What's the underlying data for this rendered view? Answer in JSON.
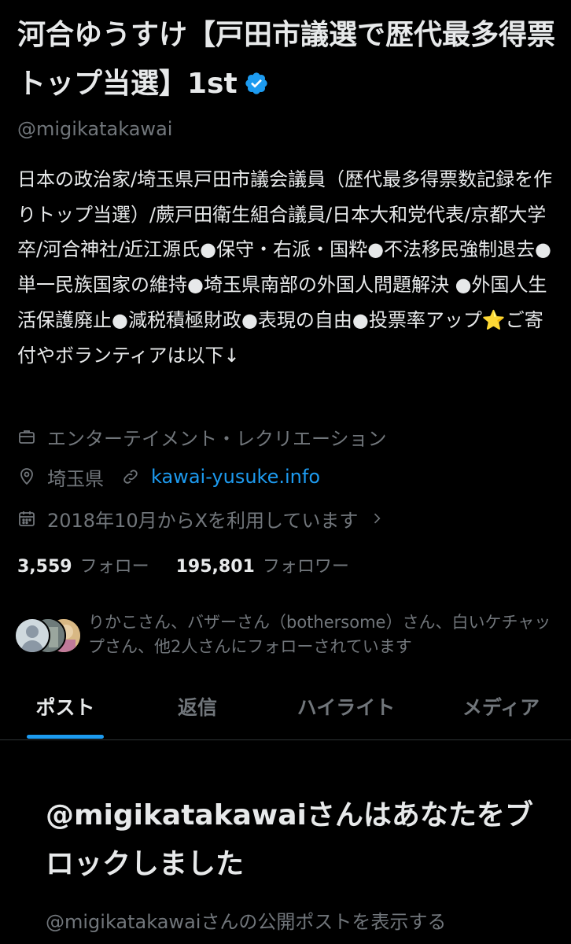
{
  "profile": {
    "display_name": "河合ゆうすけ【戸田市議選で歴代最多得票トップ当選】1st",
    "handle": "@migikatakawai",
    "bio": "日本の政治家/埼玉県戸田市議会議員（歴代最多得票数記録を作りトップ当選）/蕨戸田衛生組合議員/日本大和党代表/京都大学卒/河合神社/近江源氏●保守・右派・国粋●不法移民強制退去●単一民族国家の維持●埼玉県南部の外国人問題解決 ●外国人生活保護廃止●減税積極財政●表現の自由●投票率アップ⭐️ご寄付やボランティアは以下↓",
    "category": "エンターテイメント・レクリエーション",
    "location": "埼玉県",
    "website": "kawai-yusuke.info",
    "joined": "2018年10月からXを利用しています",
    "following_count": "3,559",
    "following_label": "フォロー",
    "followers_count": "195,801",
    "followers_label": "フォロワー",
    "followed_by": "りかこさん、バザーさん（bothersome）さん、白いケチャップさん、他2人さんにフォローされています"
  },
  "tabs": [
    {
      "label": "ポスト",
      "active": true
    },
    {
      "label": "返信",
      "active": false
    },
    {
      "label": "ハイライト",
      "active": false
    },
    {
      "label": "メディア",
      "active": false
    }
  ],
  "blocked": {
    "title": "@migikatakawaiさんはあなたをブロックしました",
    "view_posts": "@migikatakawaiさんの公開ポストを表示する"
  },
  "colors": {
    "background": "#000000",
    "text": "#e7e9ea",
    "secondary": "#71767b",
    "accent": "#1d9bf0"
  },
  "icons": [
    "verified-badge-icon",
    "briefcase-icon",
    "location-pin-icon",
    "link-icon",
    "calendar-icon",
    "chevron-right-icon"
  ]
}
